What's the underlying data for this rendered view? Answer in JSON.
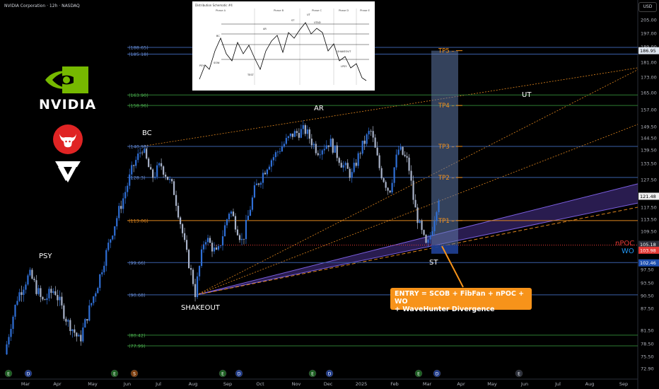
{
  "header": {
    "title": "NVIDIA Corporation · 12h · NASDAQ",
    "currency": "USD"
  },
  "logos": {
    "nvidia_text": "NVIDIA"
  },
  "schematic": {
    "title": "Distribution Schematic #4",
    "phases": [
      "Phase A",
      "Phase B",
      "Phase C",
      "Phase D",
      "Phase E"
    ],
    "labels": [
      "PSY",
      "BC",
      "AR",
      "ST",
      "UT",
      "UTAD",
      "TEST",
      "SHAKEOUT",
      "LPSY",
      "SOW"
    ]
  },
  "annotations": {
    "psy": "PSY",
    "bc": "BC",
    "ar": "AR",
    "shakeout": "SHAKEOUT",
    "st": "ST",
    "ut": "UT",
    "npoc": "nPOC",
    "wo": "WO",
    "entry_line1": "ENTRY =  SCOB + FibFan + nPOC + WO",
    "entry_line2": "+ WaveHunter Divergence"
  },
  "colors": {
    "background": "#000000",
    "up_candle": "#2f6fd6",
    "down_candle": "#a9b3c9",
    "level_line": "#3a5fa8",
    "green_level": "#2e7d32",
    "orange_level": "#e0861e",
    "target_zone": "#5e78a8",
    "fan": "#5a3fb0",
    "entry_box": "#f7931a",
    "current_price_tag": "#f0f0f0",
    "npoc": "#e53935",
    "wo": "#2196f3"
  },
  "chart_data": {
    "type": "candlestick",
    "title": "NVIDIA Corporation · 12h · NASDAQ",
    "x_tick_labels": [
      "Mar",
      "Apr",
      "May",
      "Jun",
      "Jul",
      "Aug",
      "Sep",
      "Oct",
      "Nov",
      "Dec",
      "2025",
      "Feb",
      "Mar",
      "Apr",
      "May",
      "Jun",
      "Jul",
      "Aug",
      "Sep"
    ],
    "y_tick_labels": [
      "205.00",
      "197.00",
      "189.00",
      "181.00",
      "173.00",
      "165.00",
      "157.00",
      "149.50",
      "144.50",
      "139.50",
      "133.50",
      "127.50",
      "117.50",
      "113.50",
      "109.50",
      "97.50",
      "93.50",
      "90.50",
      "87.50",
      "81.50",
      "78.50",
      "75.50",
      "72.90"
    ],
    "ylim": [
      71,
      210
    ],
    "current_price": "121.48",
    "price_tags": [
      {
        "label": "186.95",
        "value": 186.95
      },
      {
        "label": "121.48",
        "value": 121.48
      },
      {
        "label": "105.18",
        "value": 105.18
      },
      {
        "label": "103.98",
        "value": 103.98
      },
      {
        "label": "102.46",
        "value": 102.46
      }
    ],
    "horizontal_levels": [
      {
        "label": "(188.65)",
        "value": 188.65,
        "color": "level"
      },
      {
        "label": "(185.18)",
        "value": 185.18,
        "color": "level"
      },
      {
        "label": "(163.90)",
        "value": 163.9,
        "color": "green"
      },
      {
        "label": "(158.96)",
        "value": 158.96,
        "color": "green"
      },
      {
        "label": "(140.98)",
        "value": 140.98,
        "color": "level"
      },
      {
        "label": "(128.3)",
        "value": 128.3,
        "color": "level"
      },
      {
        "label": "(113.06)",
        "value": 113.06,
        "color": "orange"
      },
      {
        "label": "(99.66)",
        "value": 99.66,
        "color": "level"
      },
      {
        "label": "(90.68)",
        "value": 90.68,
        "color": "level"
      },
      {
        "label": "(80.42)",
        "value": 80.42,
        "color": "green"
      },
      {
        "label": "(77.99)",
        "value": 77.99,
        "color": "green"
      }
    ],
    "targets": [
      {
        "label": "TP5",
        "value": 186.95
      },
      {
        "label": "TP4",
        "value": 158.96
      },
      {
        "label": "TP3",
        "value": 140.98
      },
      {
        "label": "TP2",
        "value": 128.3
      },
      {
        "label": "TP1",
        "value": 113.06
      }
    ],
    "target_zone": {
      "from": 102.46,
      "to": 186.95
    },
    "close_path": [
      {
        "t": 0,
        "c": 76
      },
      {
        "t": 0.02,
        "c": 90
      },
      {
        "t": 0.04,
        "c": 96
      },
      {
        "t": 0.06,
        "c": 89
      },
      {
        "t": 0.08,
        "c": 92
      },
      {
        "t": 0.1,
        "c": 84
      },
      {
        "t": 0.12,
        "c": 79
      },
      {
        "t": 0.135,
        "c": 87
      },
      {
        "t": 0.15,
        "c": 94
      },
      {
        "t": 0.17,
        "c": 108
      },
      {
        "t": 0.19,
        "c": 121
      },
      {
        "t": 0.205,
        "c": 132
      },
      {
        "t": 0.22,
        "c": 140.5
      },
      {
        "t": 0.235,
        "c": 128
      },
      {
        "t": 0.25,
        "c": 133
      },
      {
        "t": 0.27,
        "c": 124
      },
      {
        "t": 0.29,
        "c": 103
      },
      {
        "t": 0.305,
        "c": 91
      },
      {
        "t": 0.32,
        "c": 108
      },
      {
        "t": 0.34,
        "c": 102
      },
      {
        "t": 0.36,
        "c": 117
      },
      {
        "t": 0.38,
        "c": 106
      },
      {
        "t": 0.4,
        "c": 124
      },
      {
        "t": 0.42,
        "c": 133
      },
      {
        "t": 0.44,
        "c": 140
      },
      {
        "t": 0.46,
        "c": 146
      },
      {
        "t": 0.48,
        "c": 148
      },
      {
        "t": 0.5,
        "c": 139
      },
      {
        "t": 0.52,
        "c": 143
      },
      {
        "t": 0.54,
        "c": 133
      },
      {
        "t": 0.555,
        "c": 129
      },
      {
        "t": 0.57,
        "c": 140
      },
      {
        "t": 0.585,
        "c": 148
      },
      {
        "t": 0.6,
        "c": 131
      },
      {
        "t": 0.615,
        "c": 123
      },
      {
        "t": 0.63,
        "c": 140
      },
      {
        "t": 0.645,
        "c": 134
      },
      {
        "t": 0.655,
        "c": 118
      },
      {
        "t": 0.665,
        "c": 110
      },
      {
        "t": 0.675,
        "c": 104
      },
      {
        "t": 0.685,
        "c": 112
      },
      {
        "t": 0.694,
        "c": 121.48
      }
    ]
  }
}
